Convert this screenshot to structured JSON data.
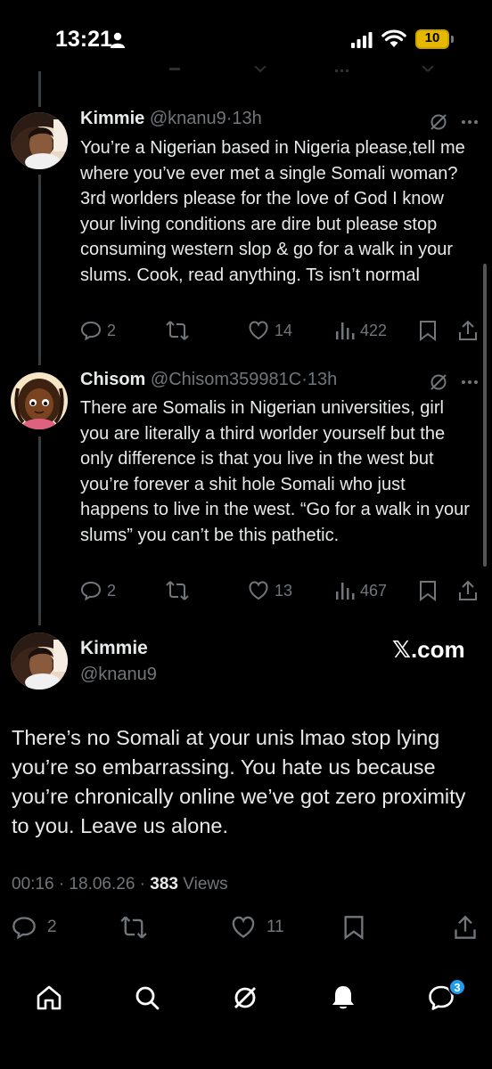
{
  "status_bar": {
    "time": "13:21",
    "battery": "10"
  },
  "tweets": [
    {
      "name": "Kimmie",
      "handle": "@knanu9",
      "separator": "·",
      "ago": "13h",
      "text": "You’re a Nigerian based in Nigeria please,tell me where you’ve ever met a single Somali woman? 3rd worlders please for the love of God I know your living conditions are dire but please stop consuming western slop & go for a walk in your slums. Cook, read anything. Ts isn’t normal",
      "replies": "2",
      "likes": "14",
      "views": "422"
    },
    {
      "name": "Chisom",
      "handle": "@Chisom359981C",
      "separator": "·",
      "ago": "13h",
      "text": "There are Somalis in Nigerian universities, girl you are literally a third worlder yourself but the only difference is that you live in the west but you’re forever a shit hole Somali who just happens to live in the west. “Go for a walk in your slums” you can’t be this pathetic.",
      "replies": "2",
      "likes": "13",
      "views": "467"
    }
  ],
  "main_tweet": {
    "name": "Kimmie",
    "handle": "@knanu9",
    "watermark": "𝕏.com",
    "text": "There’s no Somali at your unis lmao stop lying you’re so embarrassing. You hate us because you’re chronically online we’ve got zero proximity to you. Leave us alone.",
    "timestamp": "00:16 · 18.06.26 · ",
    "views_count": "383",
    "views_label": " Views",
    "replies": "2",
    "likes": "11"
  },
  "bottom_nav": {
    "messages_badge": "3"
  },
  "colors": {
    "background": "#000000",
    "text": "#e7e9ea",
    "muted": "#71767b",
    "accent": "#1d9bf0",
    "battery": "#e6b800"
  }
}
